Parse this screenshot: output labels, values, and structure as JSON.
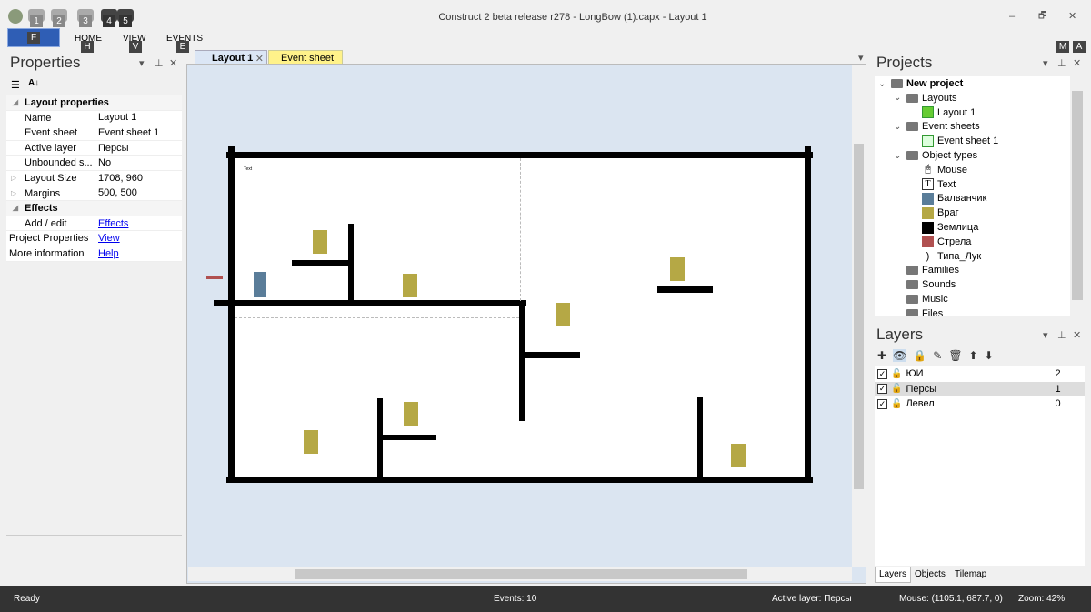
{
  "window": {
    "title": "Construct 2 beta release r278 - LongBow (1).capx - Layout 1",
    "minimize": "–",
    "restore": "🗗",
    "close": "✕"
  },
  "quick_access": [
    "1",
    "2",
    "3",
    "4",
    "5"
  ],
  "menu": {
    "file_key": "F",
    "items": [
      {
        "label": "HOME",
        "key": "H"
      },
      {
        "label": "VIEW",
        "key": "V"
      },
      {
        "label": "EVENTS",
        "key": "E"
      }
    ],
    "right_keys": [
      "M",
      "A"
    ]
  },
  "properties": {
    "title": "Properties",
    "rows": [
      {
        "type": "section",
        "label": "Layout properties"
      },
      {
        "k": "Name",
        "v": "Layout 1"
      },
      {
        "k": "Event sheet",
        "v": "Event sheet 1"
      },
      {
        "k": "Active layer",
        "v": "Персы"
      },
      {
        "k": "Unbounded s...",
        "v": "No"
      },
      {
        "k": "Layout Size",
        "v": "1708, 960",
        "expand": true
      },
      {
        "k": "Margins",
        "v": "500, 500",
        "expand": true
      },
      {
        "type": "section",
        "label": "Effects"
      },
      {
        "k": "Add / edit",
        "v": "Effects",
        "link": true
      },
      {
        "k": "Project Properties",
        "v": "View",
        "link": true,
        "top": true
      },
      {
        "k": "More information",
        "v": "Help",
        "link": true,
        "top": true
      }
    ]
  },
  "tabs": [
    {
      "label": "Layout 1",
      "active": true
    },
    {
      "label": "Event sheet 1"
    }
  ],
  "canvas": {
    "text_object": "Text"
  },
  "projects": {
    "title": "Projects",
    "items": [
      {
        "label": "New project",
        "level": 0,
        "icon": "folder",
        "bold": true,
        "chev": "⌄"
      },
      {
        "label": "Layouts",
        "level": 1,
        "icon": "folder",
        "chev": "⌄"
      },
      {
        "label": "Layout 1",
        "level": 2,
        "icon": "layout"
      },
      {
        "label": "Event sheets",
        "level": 1,
        "icon": "folder",
        "chev": "⌄"
      },
      {
        "label": "Event sheet 1",
        "level": 2,
        "icon": "eventsheet"
      },
      {
        "label": "Object types",
        "level": 1,
        "icon": "folder",
        "chev": "⌄"
      },
      {
        "label": "Mouse",
        "level": 2,
        "icon": "mouse"
      },
      {
        "label": "Text",
        "level": 2,
        "icon": "text"
      },
      {
        "label": "Балванчик",
        "level": 2,
        "color": "#5a7d99"
      },
      {
        "label": "Враг",
        "level": 2,
        "color": "#b5a845"
      },
      {
        "label": "Землица",
        "level": 2,
        "color": "#000000"
      },
      {
        "label": "Стрела",
        "level": 2,
        "color": "#b05050"
      },
      {
        "label": "Типа_Лук",
        "level": 2,
        "icon": "bow"
      },
      {
        "label": "Families",
        "level": 1,
        "icon": "folder"
      },
      {
        "label": "Sounds",
        "level": 1,
        "icon": "folder"
      },
      {
        "label": "Music",
        "level": 1,
        "icon": "folder"
      },
      {
        "label": "Files",
        "level": 1,
        "icon": "folder"
      }
    ]
  },
  "layers": {
    "title": "Layers",
    "items": [
      {
        "name": "ЮИ",
        "index": "2"
      },
      {
        "name": "Персы",
        "index": "1",
        "selected": true
      },
      {
        "name": "Левел",
        "index": "0"
      }
    ]
  },
  "bottom_tabs": [
    "Layers",
    "Objects",
    "Tilemap"
  ],
  "status": {
    "ready": "Ready",
    "events": "Events: 10",
    "active_layer": "Active layer: Персы",
    "mouse": "Mouse: (1105.1, 687.7, 0)",
    "zoom": "Zoom: 42%"
  }
}
